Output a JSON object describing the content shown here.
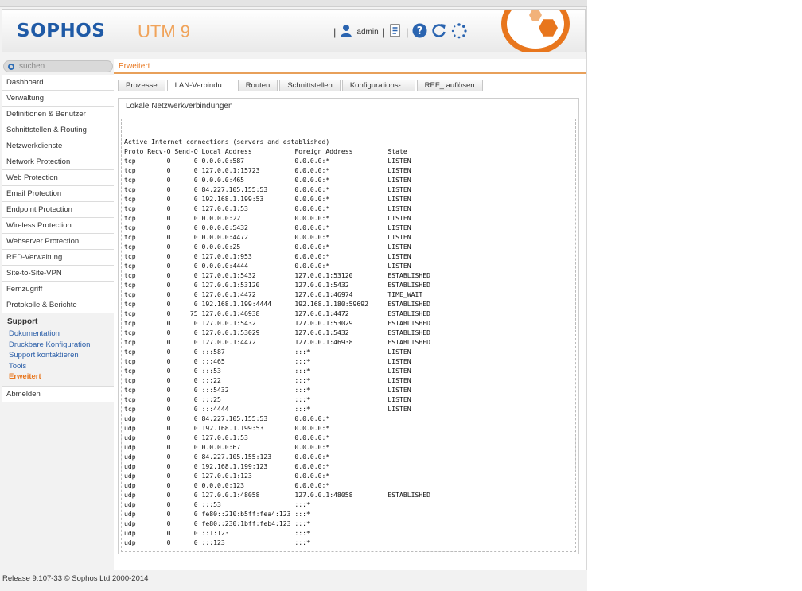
{
  "header": {
    "logo": "SOPHOS",
    "product": "UTM 9",
    "user": "admin",
    "icons": [
      "user-icon",
      "notes-icon",
      "help-icon",
      "reload-icon",
      "spinner-icon"
    ]
  },
  "search": {
    "placeholder": "suchen"
  },
  "sidebar": {
    "items": [
      "Dashboard",
      "Verwaltung",
      "Definitionen & Benutzer",
      "Schnittstellen & Routing",
      "Netzwerkdienste",
      "Network Protection",
      "Web Protection",
      "Email Protection",
      "Endpoint Protection",
      "Wireless Protection",
      "Webserver Protection",
      "RED-Verwaltung",
      "Site-to-Site-VPN",
      "Fernzugriff",
      "Protokolle & Berichte"
    ],
    "support": {
      "title": "Support",
      "subitems": [
        "Dokumentation",
        "Druckbare Konfiguration",
        "Support kontaktieren",
        "Tools",
        "Erweitert"
      ]
    },
    "logout": "Abmelden"
  },
  "breadcrumb": "Erweitert",
  "tabs": [
    "Prozesse",
    "LAN-Verbindu...",
    "Routen",
    "Schnittstellen",
    "Konfigurations-...",
    "REF_ auflösen"
  ],
  "panel": {
    "title": "Lokale Netzwerkverbindungen",
    "heading": "Active Internet connections (servers and established)",
    "columns": "Proto Recv-Q Send-Q Local Address           Foreign Address         State",
    "lines": [
      "tcp        0      0 0.0.0.0:587             0.0.0.0:*               LISTEN",
      "tcp        0      0 127.0.0.1:15723         0.0.0.0:*               LISTEN",
      "tcp        0      0 0.0.0.0:465             0.0.0.0:*               LISTEN",
      "tcp        0      0 84.227.105.155:53       0.0.0.0:*               LISTEN",
      "tcp        0      0 192.168.1.199:53        0.0.0.0:*               LISTEN",
      "tcp        0      0 127.0.0.1:53            0.0.0.0:*               LISTEN",
      "tcp        0      0 0.0.0.0:22              0.0.0.0:*               LISTEN",
      "tcp        0      0 0.0.0.0:5432            0.0.0.0:*               LISTEN",
      "tcp        0      0 0.0.0.0:4472            0.0.0.0:*               LISTEN",
      "tcp        0      0 0.0.0.0:25              0.0.0.0:*               LISTEN",
      "tcp        0      0 127.0.0.1:953           0.0.0.0:*               LISTEN",
      "tcp        0      0 0.0.0.0:4444            0.0.0.0:*               LISTEN",
      "tcp        0      0 127.0.0.1:5432          127.0.0.1:53120         ESTABLISHED",
      "tcp        0      0 127.0.0.1:53120         127.0.0.1:5432          ESTABLISHED",
      "tcp        0      0 127.0.0.1:4472          127.0.0.1:46974         TIME_WAIT",
      "tcp        0      0 192.168.1.199:4444      192.168.1.180:59692     ESTABLISHED",
      "tcp        0     75 127.0.0.1:46938         127.0.0.1:4472          ESTABLISHED",
      "tcp        0      0 127.0.0.1:5432          127.0.0.1:53029         ESTABLISHED",
      "tcp        0      0 127.0.0.1:53029         127.0.0.1:5432          ESTABLISHED",
      "tcp        0      0 127.0.0.1:4472          127.0.0.1:46938         ESTABLISHED",
      "tcp        0      0 :::587                  :::*                    LISTEN",
      "tcp        0      0 :::465                  :::*                    LISTEN",
      "tcp        0      0 :::53                   :::*                    LISTEN",
      "tcp        0      0 :::22                   :::*                    LISTEN",
      "tcp        0      0 :::5432                 :::*                    LISTEN",
      "tcp        0      0 :::25                   :::*                    LISTEN",
      "tcp        0      0 :::4444                 :::*                    LISTEN",
      "udp        0      0 84.227.105.155:53       0.0.0.0:*",
      "udp        0      0 192.168.1.199:53        0.0.0.0:*",
      "udp        0      0 127.0.0.1:53            0.0.0.0:*",
      "udp        0      0 0.0.0.0:67              0.0.0.0:*",
      "udp        0      0 84.227.105.155:123      0.0.0.0:*",
      "udp        0      0 192.168.1.199:123       0.0.0.0:*",
      "udp        0      0 127.0.0.1:123           0.0.0.0:*",
      "udp        0      0 0.0.0.0:123             0.0.0.0:*",
      "udp        0      0 127.0.0.1:48058         127.0.0.1:48058         ESTABLISHED",
      "udp        0      0 :::53                   :::*",
      "udp        0      0 fe80::210:b5ff:fea4:123 :::*",
      "udp        0      0 fe80::230:1bff:feb4:123 :::*",
      "udp        0      0 ::1:123                 :::*",
      "udp        0      0 :::123                  :::*"
    ]
  },
  "footer": "Release 9.107-33  © Sophos Ltd 2000-2014",
  "colors": {
    "brand_blue": "#1f5aa6",
    "accent_orange": "#e8761d"
  }
}
